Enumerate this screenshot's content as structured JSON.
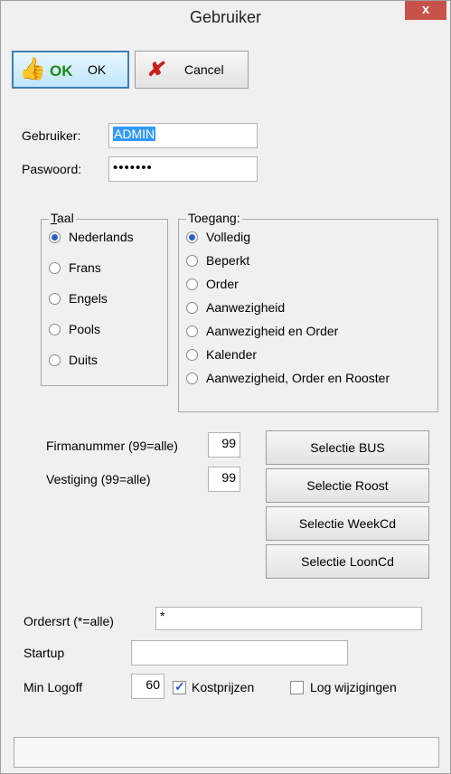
{
  "window": {
    "title": "Gebruiker",
    "close_label": "x"
  },
  "toolbar": {
    "ok_icon_text": "OK",
    "ok_label": "OK",
    "cancel_label": "Cancel"
  },
  "login": {
    "user_label": "Gebruiker:",
    "user_value": "ADMIN",
    "password_label": "Paswoord:",
    "password_value": "•••••••"
  },
  "taal": {
    "legend_prefix": "T",
    "legend_rest": "aal",
    "options": [
      "Nederlands",
      "Frans",
      "Engels",
      "Pools",
      "Duits"
    ],
    "selected": "Nederlands"
  },
  "toegang": {
    "legend": "Toegang:",
    "options": [
      "Volledig",
      "Beperkt",
      "Order",
      "Aanwezigheid",
      "Aanwezigheid en Order",
      "Kalender",
      "Aanwezigheid, Order en Rooster"
    ],
    "selected": "Volledig"
  },
  "filters": {
    "firma_label": "Firmanummer (99=alle)",
    "firma_value": "99",
    "vestiging_label": "Vestiging (99=alle)",
    "vestiging_value": "99"
  },
  "selection_buttons": [
    "Selectie BUS",
    "Selectie Roost",
    "Selectie WeekCd",
    "Selectie LoonCd"
  ],
  "bottom": {
    "ordersrt_label": "Ordersrt (*=alle)",
    "ordersrt_value": "*",
    "startup_label": "Startup",
    "startup_value": "",
    "logoff_label": "Min Logoff",
    "logoff_value": "60",
    "kostprijzen_label": "Kostprijzen",
    "kostprijzen_checked": true,
    "log_label": "Log wijzigingen",
    "log_checked": false
  },
  "status": {
    "text": ""
  },
  "colors": {
    "close": "#c7524a",
    "selection": "#3399ff",
    "ok_green": "#1a8a1a",
    "cancel_red": "#c8201e"
  }
}
